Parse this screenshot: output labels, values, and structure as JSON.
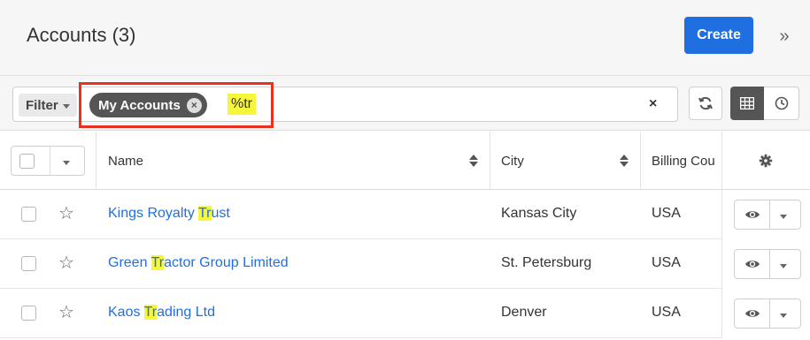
{
  "header": {
    "title": "Accounts (3)",
    "create_label": "Create",
    "toggle_glyph": "»"
  },
  "filter": {
    "dropdown_label": "Filter",
    "active_filter": "My Accounts",
    "remove_glyph": "×",
    "search_text": "%tr",
    "clear_glyph": "×"
  },
  "toolbar": {
    "icons": [
      "refresh-icon",
      "list-view-icon",
      "activity-stream-icon"
    ]
  },
  "table": {
    "columns": [
      "Name",
      "City",
      "Billing Cou"
    ],
    "rows": [
      {
        "name_pre": "Kings Royalty ",
        "name_hl": "Tr",
        "name_post": "ust",
        "city": "Kansas City",
        "country": "USA"
      },
      {
        "name_pre": "Green ",
        "name_hl": "Tr",
        "name_post": "actor Group Limited",
        "city": "St. Petersburg",
        "country": "USA"
      },
      {
        "name_pre": "Kaos ",
        "name_hl": "Tr",
        "name_post": "ading Ltd",
        "city": "Denver",
        "country": "USA"
      }
    ]
  },
  "colors": {
    "primary": "#1f6fe0",
    "highlight": "#f6f63a",
    "focus_frame": "#e8321f",
    "pill": "#555555"
  }
}
